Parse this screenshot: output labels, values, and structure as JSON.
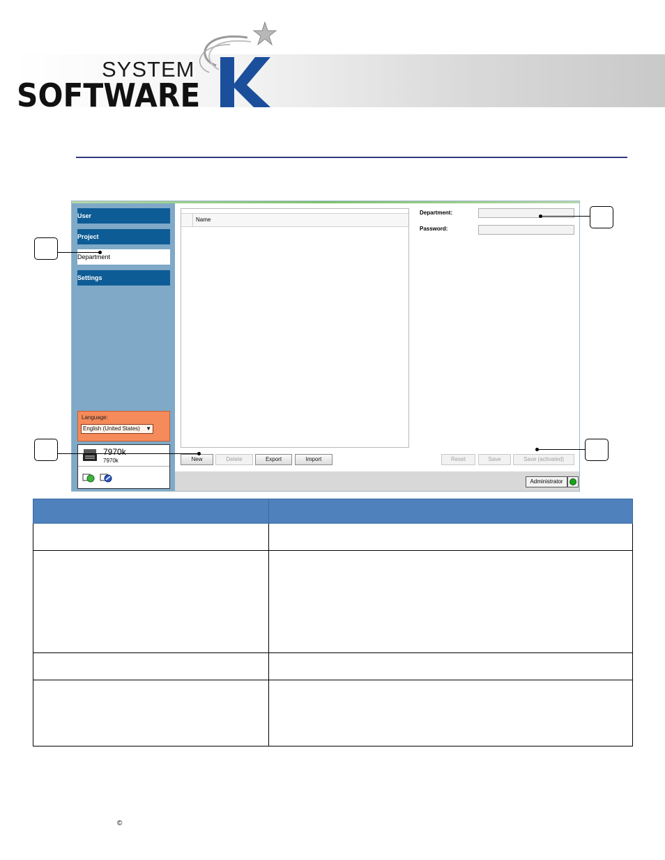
{
  "logo": {
    "word_system": "SYSTEM",
    "word_software": "SOFTWARE",
    "letter_k": "K",
    "brand_blue": "#1b4f9c"
  },
  "app": {
    "sidebar": {
      "items": [
        {
          "label": "User"
        },
        {
          "label": "Project"
        },
        {
          "label": "Department",
          "active": true
        },
        {
          "label": "Settings"
        }
      ],
      "language_label": "Language:",
      "language_value": "English (United States)",
      "device_name": "7970k",
      "device_sub": "7970k"
    },
    "list": {
      "column_name": "Name"
    },
    "form": {
      "department_label": "Department:",
      "password_label": "Password:",
      "department_value": "",
      "password_value": ""
    },
    "buttons": {
      "new": "New",
      "delete": "Delete",
      "export": "Export",
      "import": "Import",
      "reset": "Reset",
      "save": "Save",
      "save_activated": "Save (activated)"
    },
    "status": {
      "user_label": "Administrator",
      "connection_color": "#1aa31a"
    },
    "colors": {
      "nav_bg": "#0e5c96",
      "sidebar_bg": "#7fa9c7",
      "language_bg": "#f58a5a"
    }
  },
  "table": {
    "header_color": "#4f81bd",
    "rows": 4
  },
  "footer": {
    "copyright": "©"
  }
}
